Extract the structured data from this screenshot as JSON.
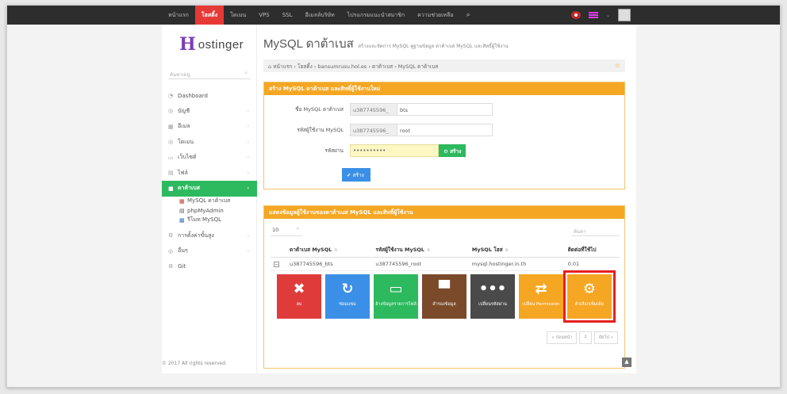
{
  "topnav": {
    "items": [
      "หน้าแรก",
      "โฮสติ้ง",
      "โดเมน",
      "VPS",
      "SSL",
      "อีเมลล์บริษัท",
      "ไปรแกรมแนะนำสมาชิก",
      "ความช่วยเหลือ"
    ],
    "active_index": 1,
    "caret": "⌄",
    "search_icon": "⌕"
  },
  "sidebar": {
    "logo_mark": "H",
    "logo_text": "ostinger",
    "search_placeholder": "ค้นหาเมนู",
    "search_icon": "⌕",
    "items": [
      {
        "icon": "◔",
        "label": "Dashboard",
        "arrow": ""
      },
      {
        "icon": "◎",
        "label": "บัญชี",
        "arrow": "‹"
      },
      {
        "icon": "▦",
        "label": "อีเมล",
        "arrow": "‹"
      },
      {
        "icon": "◎",
        "label": "โดเมน",
        "arrow": "‹"
      },
      {
        "icon": "▭",
        "label": "เว็บไซต์",
        "arrow": "‹"
      },
      {
        "icon": "▤",
        "label": "ไฟล์",
        "arrow": "‹"
      },
      {
        "icon": "■",
        "label": "ดาต้าเบส",
        "arrow": "‹"
      }
    ],
    "subitems": [
      {
        "icon": "▦",
        "label": "MySQL ดาต้าเบส"
      },
      {
        "icon": "▤",
        "label": "phpMyAdmin"
      },
      {
        "icon": "▦",
        "label": "รีโมท MySQL"
      }
    ],
    "items_after": [
      {
        "icon": "⚙",
        "label": "การตั้งค่าขั้นสูง",
        "arrow": "‹"
      },
      {
        "icon": "◎",
        "label": "อื่นๆ",
        "arrow": "‹"
      },
      {
        "icon": "⚙",
        "label": "Git",
        "arrow": ""
      }
    ]
  },
  "page": {
    "title": "MySQL ดาต้าเบส",
    "subtitle": "สร้างและจัดการ MySQL ดูฐานข้อมูล ดาต้าเบส MySQL และสิทธิ์ผู้ใช้งาน",
    "breadcrumb": "หน้าแรก › โฮสติ้ง › bansumrusu.hol.es › ดาต้าเบส › MySQL ดาต้าเบส",
    "breadcrumb_icon": "⌂",
    "star": "☆"
  },
  "create_panel": {
    "title": "สร้าง MySQL ดาต้าเบส และสิทธิ์ผู้ใช้งานใหม่",
    "db_label": "ชื่อ MySQL ดาต้าเบส",
    "db_prefix": "u387745596_",
    "db_value": "bts",
    "user_label": "รหัสผู้ใช้งาน MySQL",
    "user_prefix": "u387745596_",
    "user_value": "root",
    "pass_label": "รหัสผ่าน",
    "pass_value": "••••••••••",
    "generate_label": "สร้าง",
    "submit_label": "สร้าง"
  },
  "list_panel": {
    "title": "แสดงข้อมูลผู้ใช้งานของดาต้าเบส MySQL และสิทธิ์ผู้ใช้งาน",
    "page_length": "10",
    "length_caret": "⌃",
    "search_placeholder": "ค้นหา",
    "columns": [
      "ดาต้าเบส MySQL",
      "รหัสผู้ใช้งาน MySQL",
      "MySQL โฮส",
      "ติดต่อที่ใช้ไป"
    ],
    "sort_icon": "⇅",
    "expand_icon": "−",
    "rows": [
      [
        "u387745596_bts",
        "u387745596_root",
        "mysql.hostinger.in.th",
        "0.01"
      ]
    ],
    "actions": [
      {
        "icon": "✖",
        "label": "ลบ",
        "color": "#e03b3b"
      },
      {
        "icon": "↻",
        "label": "ซ่อมแซม",
        "color": "#3b8fe6"
      },
      {
        "icon": "▭",
        "label": "ล้างข้อมูลรายการไฟล์",
        "color": "#2db95e"
      },
      {
        "icon": "▀",
        "label": "สำรองข้อมูล",
        "color": "#7a4a2a"
      },
      {
        "icon": "•••",
        "label": "เปลี่ยนรหัสผ่าน",
        "color": "#4a4a4a"
      },
      {
        "icon": "⇄",
        "label": "เปลี่ยน Permission",
        "color": "#f5a623"
      },
      {
        "icon": "⚙",
        "label": "ตัวเลือกเพิ่มเติม",
        "color": "#f5a623"
      }
    ],
    "selected_action": 6,
    "pager": [
      "« ก่อนหน้า",
      "1",
      "ถัดไป »"
    ]
  },
  "footer": {
    "copyright": "© 2017 All rights reserved.",
    "scroll_top_icon": "▲"
  }
}
